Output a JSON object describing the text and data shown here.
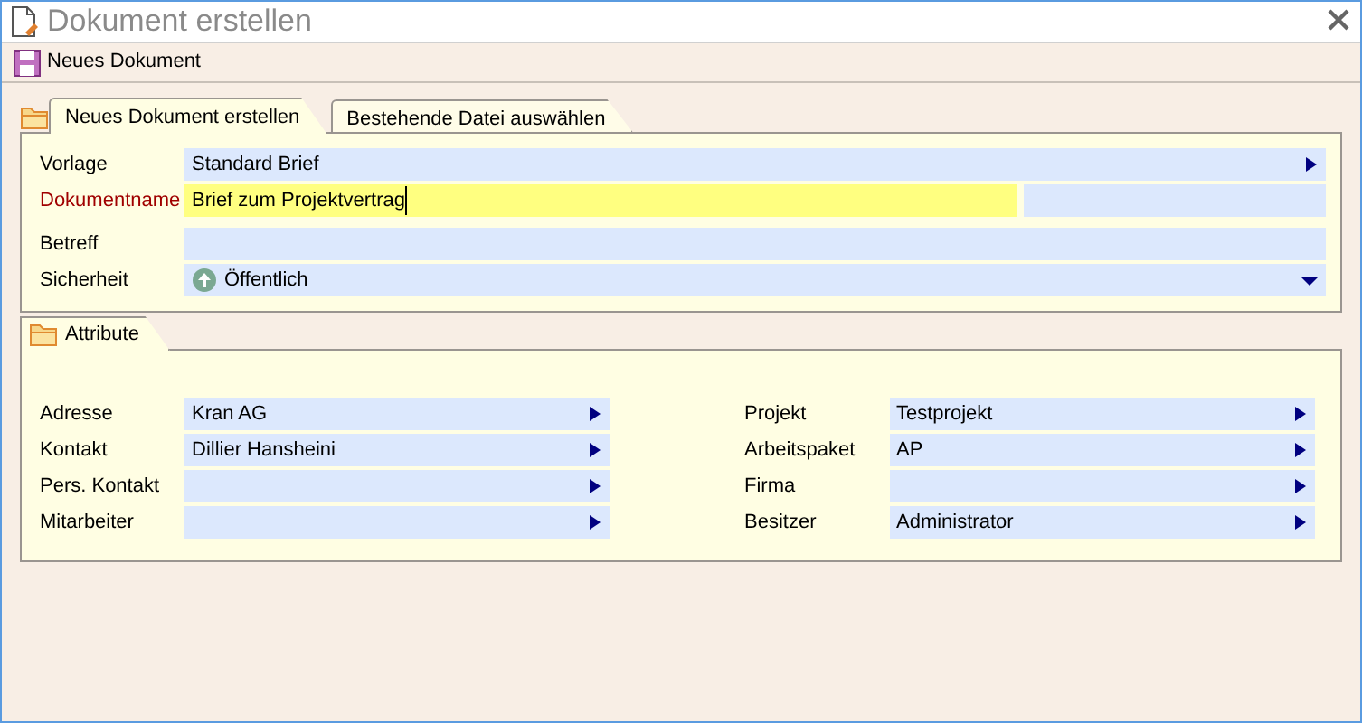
{
  "window": {
    "title": "Dokument erstellen"
  },
  "toolbar": [
    {
      "label": "Neues Dokument"
    }
  ],
  "tabs": [
    {
      "label": "Neues Dokument erstellen",
      "selected": true
    },
    {
      "label": "Bestehende Datei auswählen",
      "selected": false
    }
  ],
  "fields": [
    {
      "label": "Vorlage",
      "value": "Standard Brief",
      "kind": "lookup",
      "required": false
    },
    {
      "label": "Dokumentname",
      "value": "Brief zum Projektvertrag",
      "kind": "text",
      "required": true,
      "focused": true
    },
    {
      "label": "Betreff",
      "kind": "text",
      "required": false,
      "focused": false
    },
    {
      "label": "Sicherheit",
      "value": "Öffentlich",
      "kind": "dropdown",
      "required": false
    }
  ],
  "attributes": {
    "title": "Attribute",
    "left": [
      {
        "label": "Adresse",
        "value": "Kran AG"
      },
      {
        "label": "Kontakt",
        "value": "Dillier Hansheini"
      },
      {
        "label": "Pers. Kontakt"
      },
      {
        "label": "Mitarbeiter"
      }
    ],
    "right": [
      {
        "label": "Projekt",
        "value": "Testprojekt"
      },
      {
        "label": "Arbeitspaket",
        "value": "AP"
      },
      {
        "label": "Firma"
      },
      {
        "label": "Besitzer",
        "value": "Administrator"
      }
    ]
  }
}
